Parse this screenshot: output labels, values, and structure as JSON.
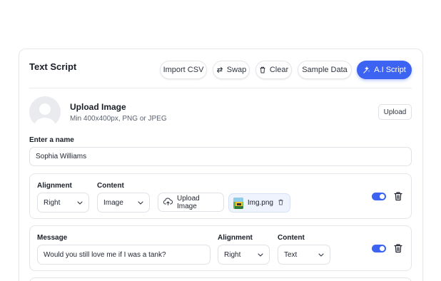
{
  "header": {
    "title": "Text Script",
    "buttons": {
      "import_csv": "Import CSV",
      "swap": "Swap",
      "clear": "Clear",
      "sample_data": "Sample Data",
      "ai_script": "A.I Script"
    }
  },
  "upload": {
    "title": "Upload Image",
    "hint": "Min 400x400px, PNG or JPEG",
    "button": "Upload"
  },
  "name_field": {
    "label": "Enter a name",
    "value": "Sophia Williams"
  },
  "row1": {
    "alignment_label": "Alignment",
    "alignment_value": "Right",
    "content_label": "Content",
    "content_value": "Image",
    "upload_button": "Upload Image",
    "file_name": "Img.png",
    "toggle_on": true
  },
  "row2": {
    "message_label": "Message",
    "message_value": "Would you still love me if I was a tank?",
    "alignment_label": "Alignment",
    "alignment_value": "Right",
    "content_label": "Content",
    "content_value": "Text",
    "toggle_on": true
  },
  "colors": {
    "accent": "#3d63f2",
    "border": "#dfe2e7"
  }
}
